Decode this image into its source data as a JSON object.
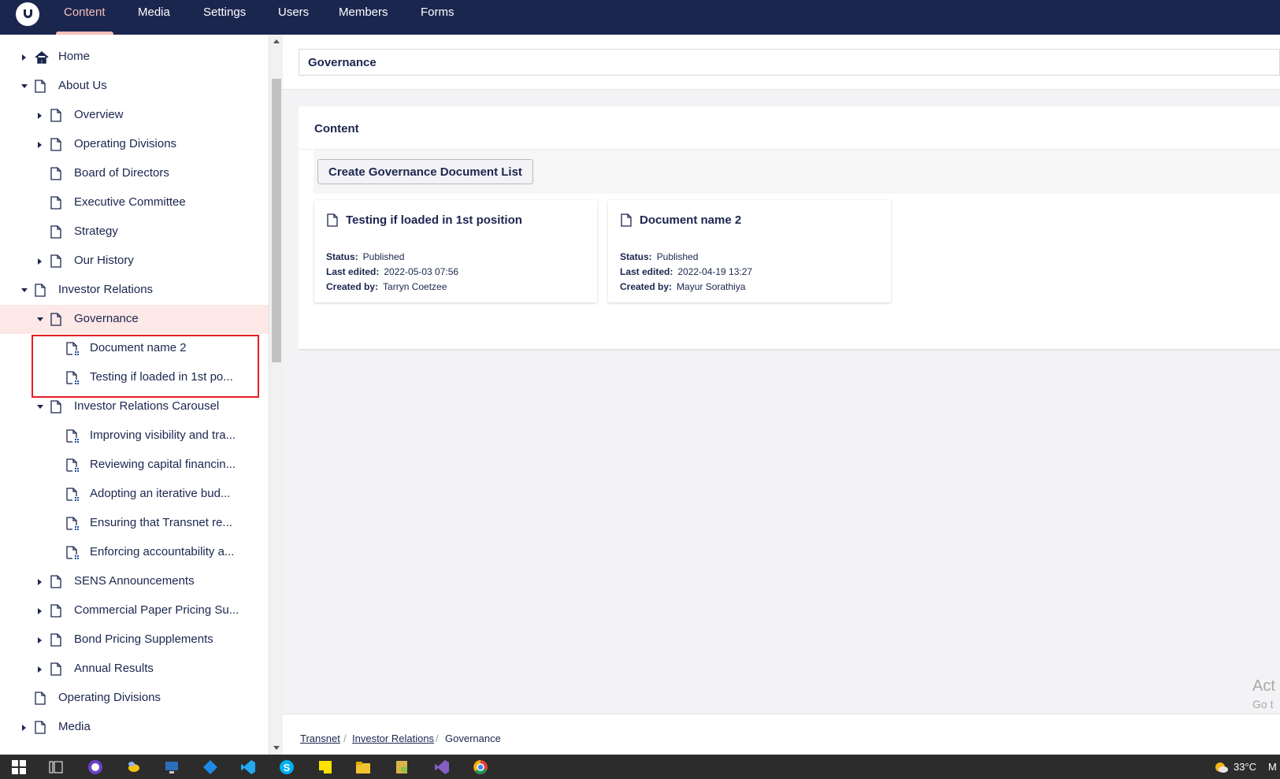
{
  "topnav": {
    "items": [
      "Content",
      "Media",
      "Settings",
      "Users",
      "Members",
      "Forms"
    ],
    "active": "Content"
  },
  "tree": {
    "nodes": [
      {
        "label": "Home",
        "icon": "home-icon",
        "caret": "right"
      },
      {
        "label": "About Us",
        "icon": "document-icon",
        "caret": "down"
      },
      {
        "label": "Overview",
        "icon": "document-icon",
        "caret": "right"
      },
      {
        "label": "Operating Divisions",
        "icon": "document-icon",
        "caret": "right"
      },
      {
        "label": "Board of Directors",
        "icon": "document-icon",
        "caret": ""
      },
      {
        "label": "Executive Committee",
        "icon": "document-icon",
        "caret": ""
      },
      {
        "label": "Strategy",
        "icon": "document-icon",
        "caret": ""
      },
      {
        "label": "Our History",
        "icon": "document-icon",
        "caret": "right"
      },
      {
        "label": "Investor Relations",
        "icon": "document-icon",
        "caret": "down"
      },
      {
        "label": "Governance",
        "icon": "document-icon",
        "caret": "down",
        "selected": true
      },
      {
        "label": "Document name 2",
        "icon": "document-unpublished-icon",
        "caret": ""
      },
      {
        "label": "Testing if loaded in 1st po...",
        "icon": "document-unpublished-icon",
        "caret": ""
      },
      {
        "label": "Investor Relations Carousel",
        "icon": "document-icon",
        "caret": "down"
      },
      {
        "label": "Improving visibility and tra...",
        "icon": "document-unpublished-icon",
        "caret": ""
      },
      {
        "label": "Reviewing capital financin...",
        "icon": "document-unpublished-icon",
        "caret": ""
      },
      {
        "label": "Adopting an iterative bud...",
        "icon": "document-unpublished-icon",
        "caret": ""
      },
      {
        "label": "Ensuring that Transnet re...",
        "icon": "document-unpublished-icon",
        "caret": ""
      },
      {
        "label": "Enforcing accountability a...",
        "icon": "document-unpublished-icon",
        "caret": ""
      },
      {
        "label": "SENS Announcements",
        "icon": "document-icon",
        "caret": "right"
      },
      {
        "label": "Commercial Paper Pricing Su...",
        "icon": "document-icon",
        "caret": "right"
      },
      {
        "label": "Bond Pricing Supplements",
        "icon": "document-icon",
        "caret": "right"
      },
      {
        "label": "Annual Results",
        "icon": "document-icon",
        "caret": "right"
      },
      {
        "label": "Operating Divisions",
        "icon": "document-icon",
        "caret": ""
      },
      {
        "label": "Media",
        "icon": "document-icon",
        "caret": "right"
      }
    ]
  },
  "editor": {
    "name_value": "Governance",
    "panel_title": "Content",
    "create_button": "Create Governance Document List",
    "cards": [
      {
        "title": "Testing if loaded in 1st position",
        "status_label": "Status:",
        "status": "Published",
        "edited_label": "Last edited:",
        "edited": "2022-05-03 07:56",
        "created_label": "Created by:",
        "created": "Tarryn Coetzee"
      },
      {
        "title": "Document name 2",
        "status_label": "Status:",
        "status": "Published",
        "edited_label": "Last edited:",
        "edited": "2022-04-19 13:27",
        "created_label": "Created by:",
        "created": "Mayur Sorathiya"
      }
    ]
  },
  "breadcrumb": {
    "items": [
      "Transnet",
      "Investor Relations",
      "Governance"
    ],
    "separator": "/"
  },
  "watermark": {
    "line1": "Act",
    "line2": "Go t"
  },
  "taskbar": {
    "icons": [
      "windows-start-icon",
      "task-view-icon",
      "github-icon",
      "app-bee-icon",
      "remote-desktop-icon",
      "network-app-icon",
      "vscode-icon",
      "skype-icon",
      "sticky-notes-icon",
      "file-explorer-icon",
      "sql-tool-icon",
      "visual-studio-icon",
      "chrome-icon"
    ],
    "temperature": "33°C",
    "extra": "M"
  },
  "colors": {
    "brand_navy": "#1b264f",
    "accent_pink": "#f5c1bc",
    "selected_bg": "#fce8e7",
    "highlight_red": "#e31e24"
  }
}
